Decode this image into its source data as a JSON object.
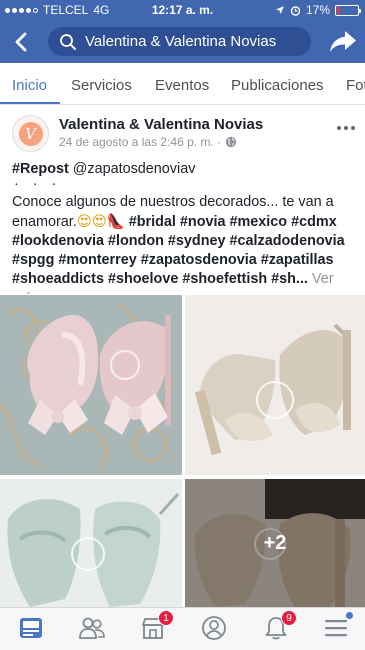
{
  "status_bar": {
    "carrier": "TELCEL",
    "network": "4G",
    "time": "12:17 a. m.",
    "battery": "17%",
    "battery_level": 0.17
  },
  "search": {
    "query": "Valentina & Valentina Novias"
  },
  "tabs": [
    {
      "label": "Inicio",
      "active": true
    },
    {
      "label": "Servicios",
      "active": false
    },
    {
      "label": "Eventos",
      "active": false
    },
    {
      "label": "Publicaciones",
      "active": false
    },
    {
      "label": "Fot",
      "active": false
    }
  ],
  "post": {
    "avatar_letter": "V",
    "page_name": "Valentina & Valentina Novias",
    "timestamp": "24 de agosto a las 2:46 p. m. ·",
    "repost_tag": "#Repost",
    "repost_user": "@zapatosdenoviav",
    "dots": "· · ·",
    "text_line1": "Conoce algunos de nuestros decorados... te van a",
    "text_line2_start": "enamorar.",
    "text_line2_emoji": "😍😍",
    "text_line2_shoe": "👠",
    "hashtags_line2": "#bridal #novia #mexico #cdmx",
    "hashtags_line3": "#lookdenovia #london #sydney #calzadodenovia",
    "hashtags_line4": "#spgg #monterrey #zapatosdenovia #zapatillas",
    "hashtags_line5": "#shoeaddicts #shoelove #shoefettish #sh...",
    "see_more": "Ver más",
    "more_photos": "+2"
  },
  "bottom_nav": {
    "marketplace_badge": "1",
    "notifications_badge": "9"
  },
  "colors": {
    "header_bg": "#4167b1",
    "accent": "#4a76c8",
    "badge": "#e41e3f"
  }
}
